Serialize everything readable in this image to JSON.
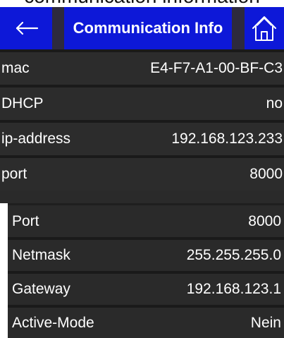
{
  "top_caption": "communication information",
  "header": {
    "title": "Communication Info"
  },
  "main_rows": [
    {
      "label": "mac",
      "value": "E4-F7-A1-00-BF-C3"
    },
    {
      "label": "DHCP",
      "value": "no"
    },
    {
      "label": "ip-address",
      "value": "192.168.123.233"
    },
    {
      "label": "port",
      "value": "8000"
    }
  ],
  "secondary_rows": [
    {
      "label": "Port",
      "value": "8000"
    },
    {
      "label": "Netmask",
      "value": "255.255.255.0"
    },
    {
      "label": "Gateway",
      "value": "192.168.123.1"
    },
    {
      "label": "Active-Mode",
      "value": "Nein"
    }
  ],
  "icons": {
    "back": "back-arrow-icon",
    "home": "home-icon"
  },
  "colors": {
    "header_blue": "#0d18d8",
    "panel_dark": "#2c2c2c",
    "text": "#ffffff"
  }
}
